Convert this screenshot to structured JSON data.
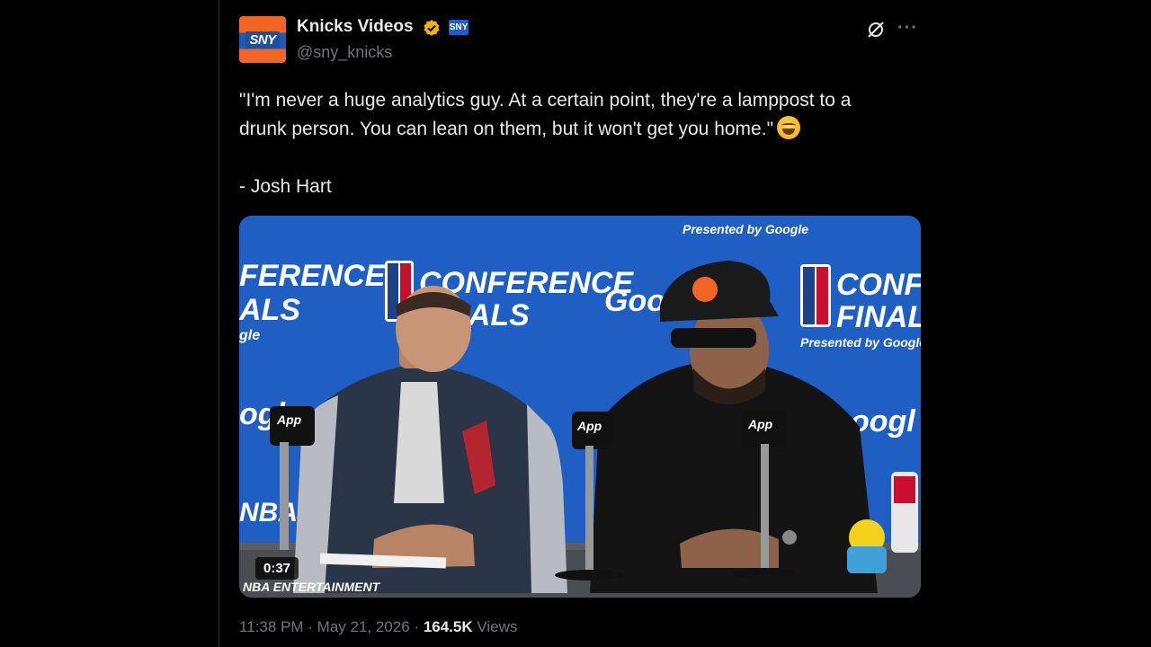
{
  "author": {
    "display_name": "Knicks Videos",
    "handle": "@sny_knicks",
    "avatar_text": "SNY",
    "affiliate_badge_text": "SNY",
    "verified_color": "#f4b400"
  },
  "tweet": {
    "text_line1": "\"I'm never a huge analytics guy. At a certain point, they're a lamppost to a",
    "text_line2": "drunk person. You can lean on them, but it won't get you home.\"",
    "text_line3": "- Josh Hart",
    "emoji": "laughing-crying-emoji"
  },
  "media": {
    "duration": "0:37",
    "backdrop_texts": {
      "presented_by_google": "Presented by Google",
      "conference": "CONFERENCE",
      "finals": "FINALS",
      "google": "Google",
      "conference_partial_left": "FERENCE",
      "finals_partial_left": "ALS",
      "google_partial_left": "gle",
      "conference_partial_right": "CONFER",
      "finals_right": "FINALS",
      "presented_right": "Presented by Google",
      "google_center": "Goo",
      "oogl_left": "ogl",
      "oogl_right": "oogl",
      "nba_app": "App",
      "watermark": "NBA ENTERTAINMENT",
      "nba": "NBA"
    }
  },
  "meta": {
    "time": "11:38 PM",
    "date": "May 21, 2026",
    "views_count": "164.5K",
    "views_label": "Views",
    "separator": "·"
  },
  "colors": {
    "background": "#000000",
    "backdrop_blue": "#1f5fc4",
    "text_primary": "#e7e9ea",
    "text_secondary": "#71767b"
  }
}
